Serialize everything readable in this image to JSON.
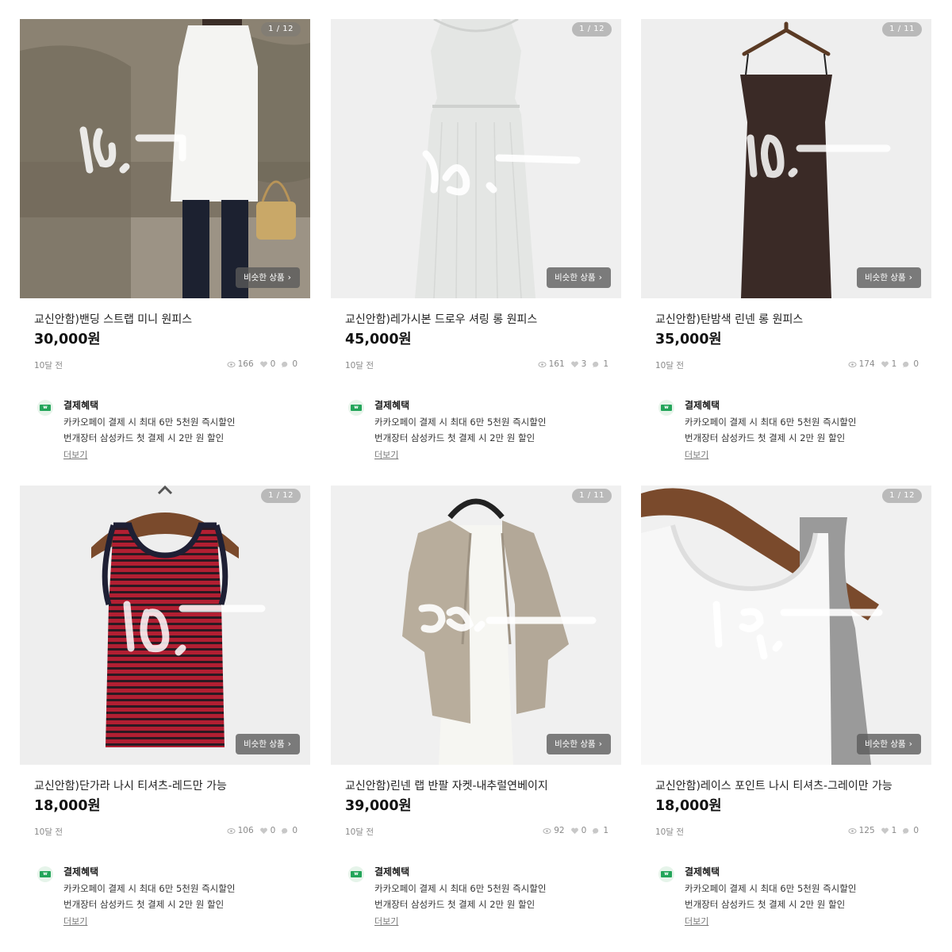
{
  "listings": [
    {
      "image_counter": "1 / 12",
      "similar_label": "비슷한 상품",
      "title": "교신안함)밴딩 스트랩 미니 원피스",
      "price": "30,000원",
      "time": "10달 전",
      "views": "166",
      "likes": "0",
      "chats": "0",
      "benefit": {
        "title": "결제혜택",
        "line1": "카카오페이 결제 시 최대 6만 5천원 즉시할인",
        "line2": "번개장터 삼성카드 첫 결제 시 2만 원  할인",
        "more": "더보기"
      }
    },
    {
      "image_counter": "1 / 12",
      "similar_label": "비슷한 상품",
      "title": "교신안함)레가시본 드로우 셔링 롱 원피스",
      "price": "45,000원",
      "time": "10달 전",
      "views": "161",
      "likes": "3",
      "chats": "1",
      "benefit": {
        "title": "결제혜택",
        "line1": "카카오페이 결제 시 최대 6만 5천원 즉시할인",
        "line2": "번개장터 삼성카드 첫 결제 시 2만 원  할인",
        "more": "더보기"
      }
    },
    {
      "image_counter": "1 / 11",
      "similar_label": "비슷한 상품",
      "title": "교신안함)탄밤색 린넨 롱 원피스",
      "price": "35,000원",
      "time": "10달 전",
      "views": "174",
      "likes": "1",
      "chats": "0",
      "benefit": {
        "title": "결제혜택",
        "line1": "카카오페이 결제 시 최대 6만 5천원 즉시할인",
        "line2": "번개장터 삼성카드 첫 결제 시 2만 원  할인",
        "more": "더보기"
      }
    },
    {
      "image_counter": "1 / 12",
      "similar_label": "비슷한 상품",
      "title": "교신안함)단가라 나시 티셔츠-레드만 가능",
      "price": "18,000원",
      "time": "10달 전",
      "views": "106",
      "likes": "0",
      "chats": "0",
      "benefit": {
        "title": "결제혜택",
        "line1": "카카오페이 결제 시 최대 6만 5천원 즉시할인",
        "line2": "번개장터 삼성카드 첫 결제 시 2만 원  할인",
        "more": "더보기"
      }
    },
    {
      "image_counter": "1 / 11",
      "similar_label": "비슷한 상품",
      "title": "교신안함)린넨 랩 반팔 자켓-내추럴연베이지",
      "price": "39,000원",
      "time": "10달 전",
      "views": "92",
      "likes": "0",
      "chats": "1",
      "benefit": {
        "title": "결제혜택",
        "line1": "카카오페이 결제 시 최대 6만 5천원 즉시할인",
        "line2": "번개장터 삼성카드 첫 결제 시 2만 원  할인",
        "more": "더보기"
      }
    },
    {
      "image_counter": "1 / 12",
      "similar_label": "비슷한 상품",
      "title": "교신안함)레이스 포인트 나시 티셔츠-그레이만 가능",
      "price": "18,000원",
      "time": "10달 전",
      "views": "125",
      "likes": "1",
      "chats": "0",
      "benefit": {
        "title": "결제혜택",
        "line1": "카카오페이 결제 시 최대 6만 5천원 즉시할인",
        "line2": "번개장터 삼성카드 첫 결제 시 2만 원  할인",
        "more": "더보기"
      }
    }
  ],
  "icons": {
    "views": "eye-icon",
    "likes": "heart-icon",
    "chats": "chat-bubble-icon",
    "similar_chevron": "chevron-right-icon",
    "benefit_logo": "payment-logo-icon"
  },
  "colors": {
    "benefit_green": "#23a55a",
    "counter_bg": "#8a8a8a",
    "price": "#111111"
  }
}
